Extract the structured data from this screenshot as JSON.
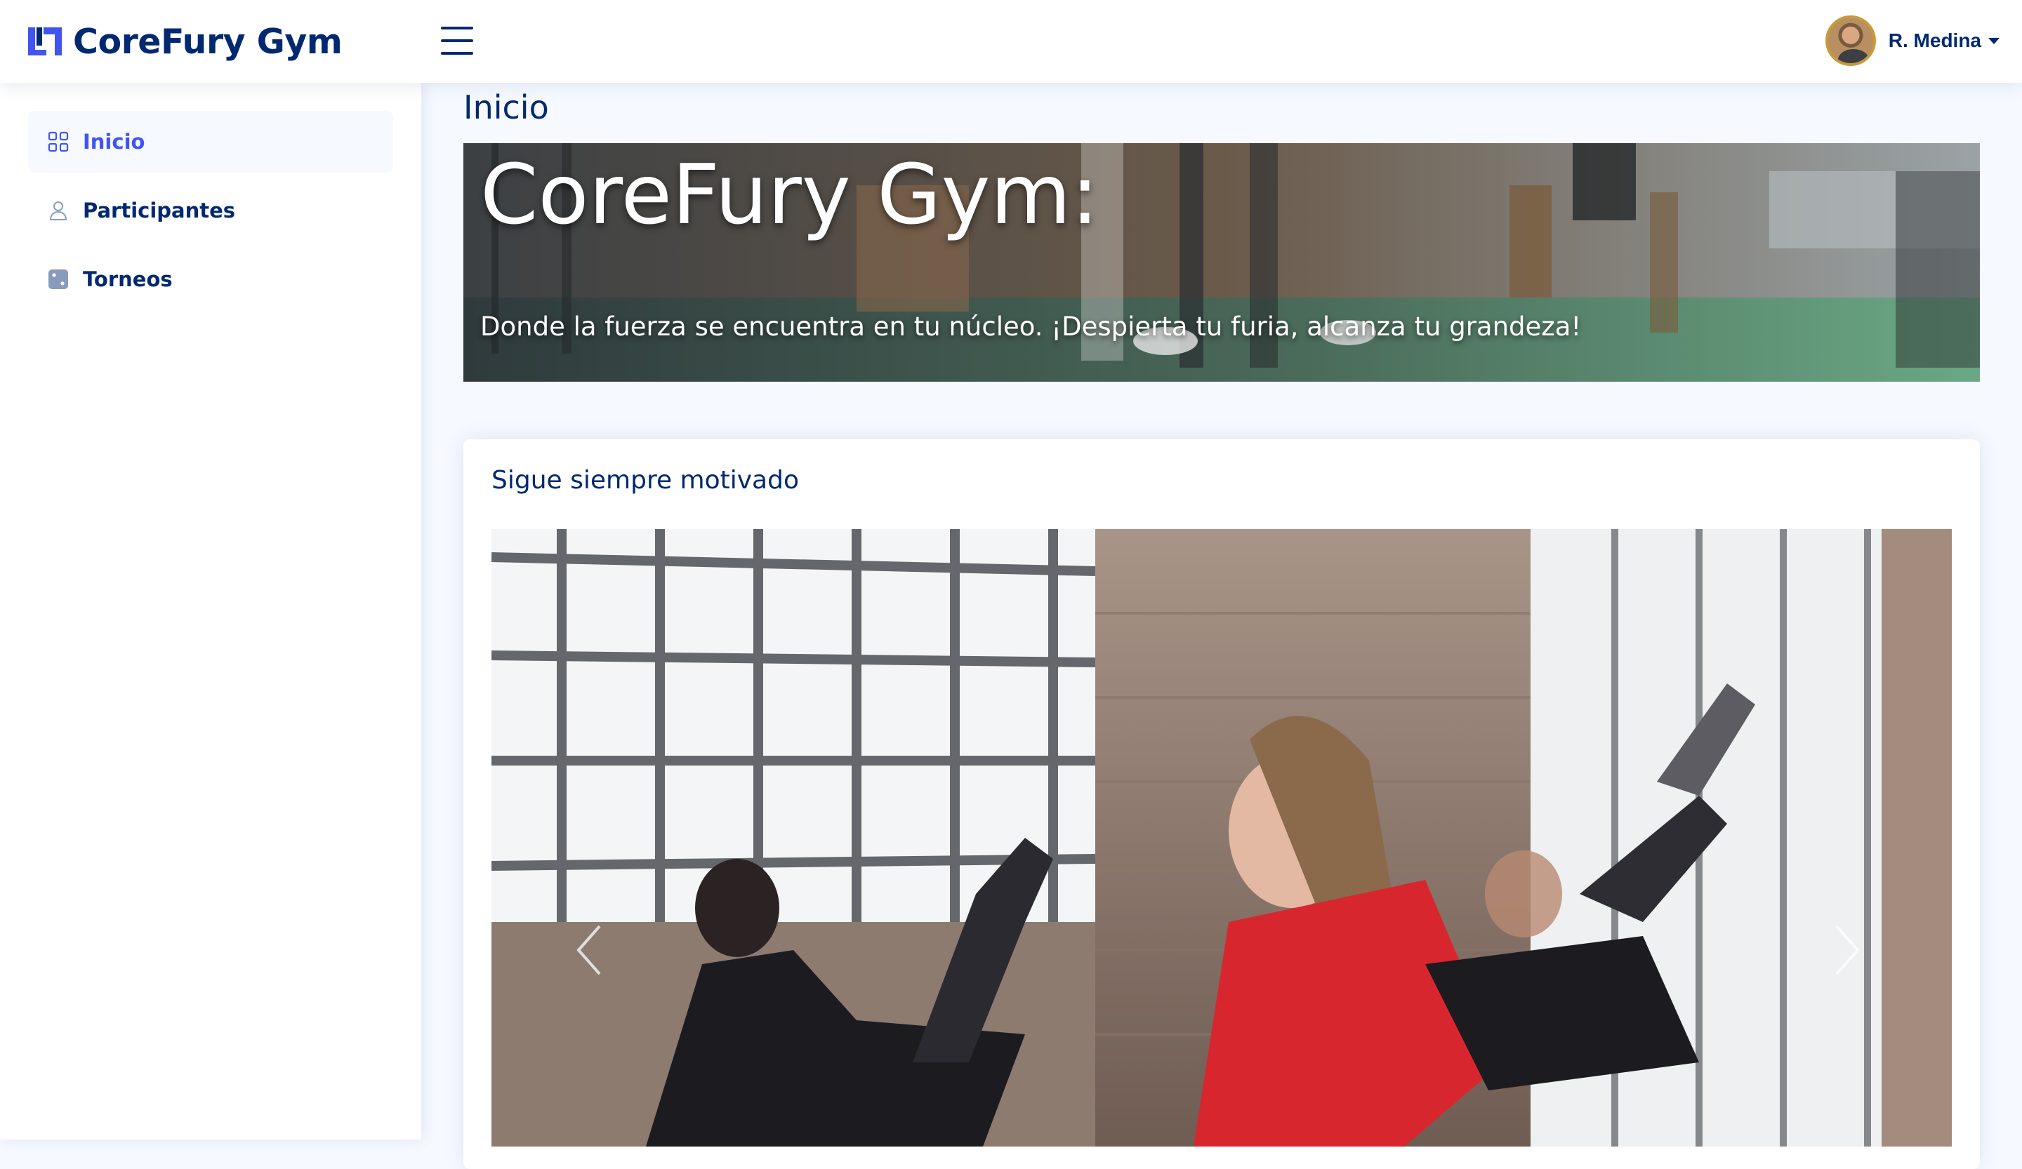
{
  "header": {
    "brand": "CoreFury Gym",
    "menu_icon": "hamburger-menu-icon",
    "user_name": "R. Medina",
    "colors": {
      "brand": "#012970",
      "accent": "#4154f1",
      "logo": "#4154f1"
    }
  },
  "sidebar": {
    "items": [
      {
        "label": "Inicio",
        "icon": "grid-icon",
        "active": true
      },
      {
        "label": "Participantes",
        "icon": "person-icon",
        "active": false
      },
      {
        "label": "Torneos",
        "icon": "dice-icon",
        "active": false
      }
    ]
  },
  "main": {
    "page_title": "Inicio",
    "banner": {
      "title": "CoreFury Gym:",
      "subtitle": "Donde la fuerza se encuentra en tu núcleo. ¡Despierta tu furia, alcanza tu grandeza!"
    },
    "card": {
      "title": "Sigue siempre motivado",
      "carousel": {
        "prev_icon": "chevron-left-icon",
        "next_icon": "chevron-right-icon"
      }
    }
  }
}
